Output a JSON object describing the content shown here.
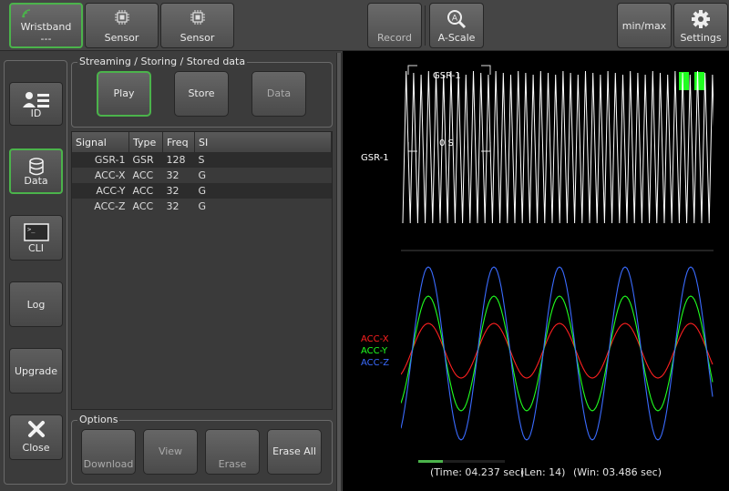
{
  "topbar": {
    "wristband": {
      "label": "Wristband",
      "sub": "---"
    },
    "sensor1": "Sensor",
    "sensor2": "Sensor",
    "record": "Record",
    "ascale": "A-Scale",
    "minmax": "min/max",
    "settings": "Settings"
  },
  "sidebar": {
    "items": [
      {
        "label": "ID",
        "icon": "id-card-icon",
        "active": false
      },
      {
        "label": "Data",
        "icon": "database-icon",
        "active": true
      },
      {
        "label": "CLI",
        "icon": "terminal-icon",
        "active": false
      },
      {
        "label": "Log",
        "icon": "",
        "active": false
      },
      {
        "label": "Upgrade",
        "icon": "",
        "active": false
      },
      {
        "label": "Close",
        "icon": "close-icon",
        "active": false
      }
    ]
  },
  "streaming": {
    "legend": "Streaming / Storing / Stored data",
    "play": "Play",
    "store": "Store",
    "data": "Data"
  },
  "table": {
    "headers": [
      "Signal",
      "Type",
      "Freq",
      "SI"
    ],
    "rows": [
      [
        "GSR-1",
        "GSR",
        "128",
        "S"
      ],
      [
        "ACC-X",
        "ACC",
        "32",
        "G"
      ],
      [
        "ACC-Y",
        "ACC",
        "32",
        "G"
      ],
      [
        "ACC-Z",
        "ACC",
        "32",
        "G"
      ]
    ]
  },
  "options": {
    "legend": "Options",
    "download": "Download",
    "view": "View",
    "erase": "Erase",
    "erase_all": "Erase All"
  },
  "graph": {
    "gsr_label": "GSR-1",
    "gsr_inner_label": "GSR-1",
    "gsr_scale": "0 S",
    "acc_labels": [
      {
        "name": "ACC-X",
        "color": "#ff2020"
      },
      {
        "name": "ACC-Y",
        "color": "#20ff20"
      },
      {
        "name": "ACC-Z",
        "color": "#3a6bff"
      }
    ],
    "progress_fraction": 0.28
  },
  "status": {
    "time": "(Time: 04.237 sec)",
    "len": "(Len: 14)",
    "win": "(Win: 03.486 sec)"
  },
  "colors": {
    "accent": "#4bb34b",
    "graph_bg": "#000000",
    "gsr": "#ffffff"
  }
}
